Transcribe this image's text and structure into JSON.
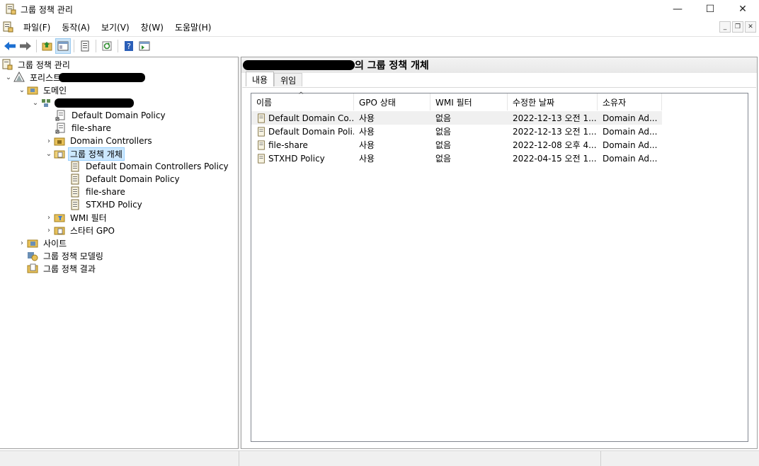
{
  "window": {
    "title": "그룹 정책 관리"
  },
  "menu": {
    "items": [
      "파일(F)",
      "동작(A)",
      "보기(V)",
      "창(W)",
      "도움말(H)"
    ]
  },
  "tree": {
    "root": "그룹 정책 관리",
    "forest_prefix": "포리스트",
    "domains": "도메인",
    "domain_gpo_default": "Default Domain Policy",
    "domain_gpo_fileshare": "file-share",
    "domain_controllers": "Domain Controllers",
    "gpo_container": "그룹 정책 개체",
    "gpos": [
      "Default Domain Controllers Policy",
      "Default Domain Policy",
      "file-share",
      "STXHD Policy"
    ],
    "wmi_filters": "WMI 필터",
    "starter_gpo": "스타터 GPO",
    "sites": "사이트",
    "modeling": "그룹 정책 모델링",
    "results": "그룹 정책 결과"
  },
  "right": {
    "header_suffix": "의 그룹 정책 개체",
    "tabs": [
      "내용",
      "위임"
    ],
    "columns": [
      "이름",
      "GPO 상태",
      "WMI 필터",
      "수정한 날짜",
      "소유자"
    ],
    "rows": [
      [
        "Default Domain Co...",
        "사용",
        "없음",
        "2022-12-13 오전 1...",
        "Domain Ad..."
      ],
      [
        "Default Domain Poli...",
        "사용",
        "없음",
        "2022-12-13 오전 1...",
        "Domain Ad..."
      ],
      [
        "file-share",
        "사용",
        "없음",
        "2022-12-08 오후 4...",
        "Domain Ad..."
      ],
      [
        "STXHD Policy",
        "사용",
        "없음",
        "2022-04-15 오전 1...",
        "Domain Ad..."
      ]
    ]
  },
  "icons": {
    "back": "back-arrow-icon",
    "forward": "forward-arrow-icon",
    "folder_up": "folder-up-icon",
    "show_tree": "show-hide-tree-icon",
    "properties": "properties-icon",
    "refresh": "refresh-icon",
    "help": "help-icon",
    "action_pane": "action-pane-icon"
  },
  "colors": {
    "selection": "#cce8ff",
    "selection_border": "#99d1ff",
    "row_hover": "#f0f0f0",
    "back_arrow": "#1c6fd1"
  }
}
